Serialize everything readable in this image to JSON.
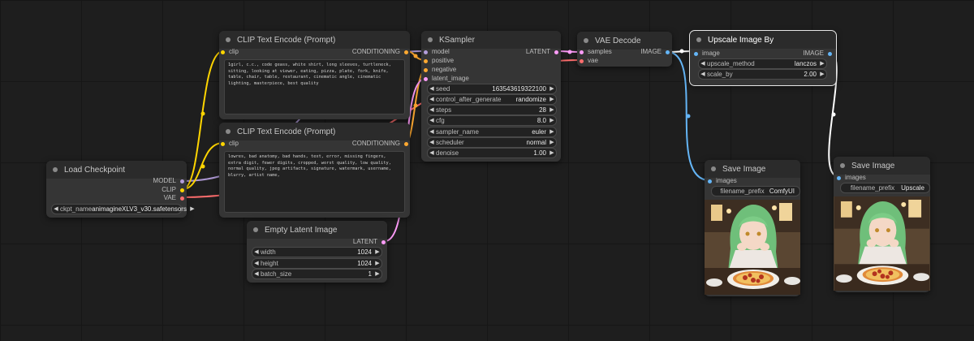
{
  "nodes": {
    "load_checkpoint": {
      "title": "Load Checkpoint",
      "outputs": [
        "MODEL",
        "CLIP",
        "VAE"
      ],
      "ckpt_name_label": "ckpt_name",
      "ckpt_name_value": "animagineXLV3_v30.safetensors"
    },
    "clip_pos": {
      "title": "CLIP Text Encode (Prompt)",
      "input": "clip",
      "output": "CONDITIONING",
      "text": "1girl, c.c., code geass, white shirt, long sleeves, turtleneck, sitting, looking at viewer, eating, pizza, plate, fork, knife, table, chair, table, restaurant, cinematic angle, cinematic lighting, masterpiece, best quality"
    },
    "clip_neg": {
      "title": "CLIP Text Encode (Prompt)",
      "input": "clip",
      "output": "CONDITIONING",
      "text": "lowres, bad anatomy, bad hands, text, error, missing fingers, extra digit, fewer digits, cropped, worst quality, low quality, normal quality, jpeg artifacts, signature, watermark, username, blurry, artist name,"
    },
    "empty_latent": {
      "title": "Empty Latent Image",
      "output": "LATENT",
      "widgets": [
        {
          "name": "width",
          "value": "1024"
        },
        {
          "name": "height",
          "value": "1024"
        },
        {
          "name": "batch_size",
          "value": "1"
        }
      ]
    },
    "ksampler": {
      "title": "KSampler",
      "inputs": [
        "model",
        "positive",
        "negative",
        "latent_image"
      ],
      "output": "LATENT",
      "widgets": [
        {
          "name": "seed",
          "value": "163543619322100"
        },
        {
          "name": "control_after_generate",
          "value": "randomize"
        },
        {
          "name": "steps",
          "value": "28"
        },
        {
          "name": "cfg",
          "value": "8.0"
        },
        {
          "name": "sampler_name",
          "value": "euler"
        },
        {
          "name": "scheduler",
          "value": "normal"
        },
        {
          "name": "denoise",
          "value": "1.00"
        }
      ]
    },
    "vae_decode": {
      "title": "VAE Decode",
      "inputs": [
        "samples",
        "vae"
      ],
      "output": "IMAGE"
    },
    "upscale": {
      "title": "Upscale Image By",
      "input": "image",
      "output": "IMAGE",
      "widgets": [
        {
          "name": "upscale_method",
          "value": "lanczos"
        },
        {
          "name": "scale_by",
          "value": "2.00"
        }
      ]
    },
    "save1": {
      "title": "Save Image",
      "input": "images",
      "prefix_label": "filename_prefix",
      "prefix_value": "ComfyUI"
    },
    "save2": {
      "title": "Save Image",
      "input": "images",
      "prefix_label": "filename_prefix",
      "prefix_value": "Upscale"
    }
  },
  "colors": {
    "canvas": "#1e1e1e",
    "node_body": "#353535",
    "node_title": "#2b2b2b",
    "link_model": "#b39ddb",
    "link_clip": "#ffd500",
    "link_vae": "#ff6e6e",
    "link_conditioning": "#ffa931",
    "link_latent": "#ff9cf9",
    "link_image": "#64b5f6",
    "link_selected": "#ffffff"
  },
  "icons": {
    "left_arrow": "left-arrow-icon",
    "right_arrow": "right-arrow-icon",
    "node_dot": "node-collapse-dot-icon"
  }
}
